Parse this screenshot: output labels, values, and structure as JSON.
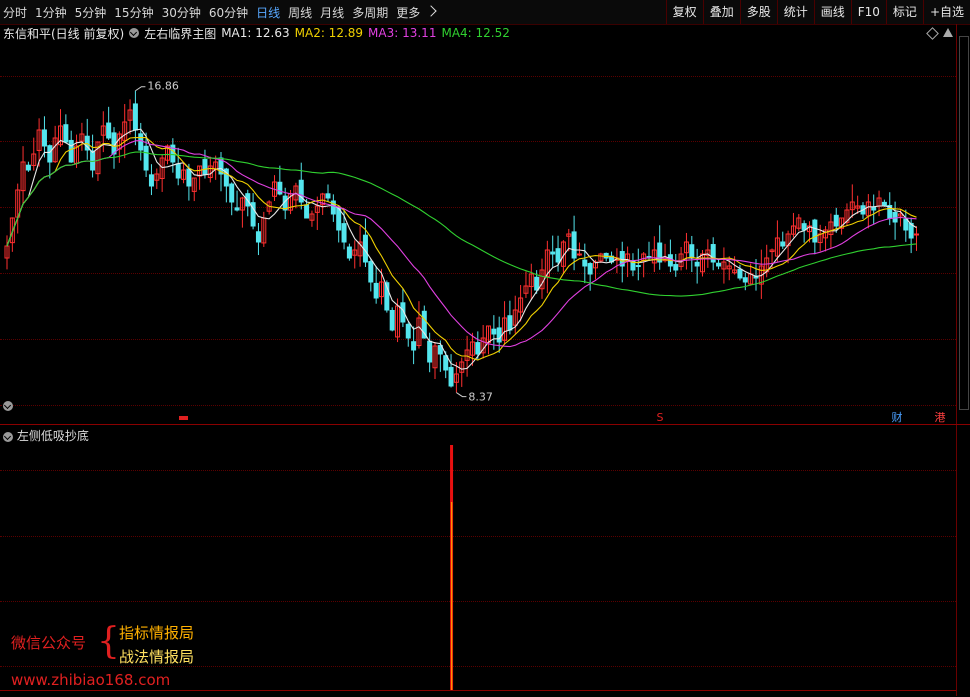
{
  "toolbar": {
    "periods": [
      {
        "label": "分时"
      },
      {
        "label": "1分钟"
      },
      {
        "label": "5分钟"
      },
      {
        "label": "15分钟"
      },
      {
        "label": "30分钟"
      },
      {
        "label": "60分钟"
      },
      {
        "label": "日线",
        "active": true
      },
      {
        "label": "周线"
      },
      {
        "label": "月线"
      },
      {
        "label": "多周期"
      },
      {
        "label": "更多"
      }
    ],
    "right_tools": [
      "复权",
      "叠加",
      "多股",
      "统计",
      "画线",
      "F10",
      "标记",
      "+自选"
    ]
  },
  "header": {
    "stock_name": "东信和平(日线 前复权)",
    "indicator": "左右临界主图",
    "ma": [
      {
        "label": "MA1: 12.63",
        "color": "#e8e8e8"
      },
      {
        "label": "MA2: 12.89",
        "color": "#f0d000"
      },
      {
        "label": "MA3: 13.11",
        "color": "#e040e0"
      },
      {
        "label": "MA4: 12.52",
        "color": "#30d030"
      }
    ]
  },
  "annotations": {
    "high": "16.86",
    "low": "8.37",
    "event_s": "S",
    "event_cai": "财",
    "event_gang": "港"
  },
  "sub_indicator": {
    "title": "左侧低吸抄底",
    "signal_day_index": 83
  },
  "watermark": {
    "wechat_label": "微信公众号",
    "brand1": "指标情报局",
    "brand2": "战法情报局",
    "site": "www.zhibiao168.com"
  },
  "colors": {
    "up": "#ff3030",
    "down": "#54e6ee",
    "ma1": "#e8e8e8",
    "ma2": "#f0d000",
    "ma3": "#e040e0",
    "ma4": "#30d030",
    "signal_red": "#e81010",
    "signal_orange": "#ff9a00"
  },
  "chart_data": {
    "type": "candlestick",
    "y_range": [
      8.0,
      17.5
    ],
    "closes": [
      12.1,
      12.8,
      13.5,
      14.2,
      14.0,
      14.4,
      15.0,
      14.6,
      14.2,
      14.8,
      15.1,
      14.7,
      14.2,
      14.6,
      14.9,
      14.5,
      14.0,
      14.7,
      15.1,
      14.8,
      14.4,
      14.9,
      15.2,
      15.5,
      15.0,
      14.5,
      14.0,
      13.6,
      13.9,
      14.3,
      14.6,
      14.2,
      13.8,
      14.0,
      13.6,
      13.8,
      14.1,
      13.9,
      14.1,
      14.2,
      13.9,
      13.6,
      13.2,
      13.0,
      13.3,
      13.1,
      12.6,
      12.2,
      12.8,
      13.2,
      13.7,
      13.4,
      13.0,
      13.4,
      13.6,
      13.2,
      12.8,
      12.9,
      13.1,
      13.4,
      13.3,
      12.9,
      12.5,
      12.2,
      11.8,
      12.0,
      12.2,
      11.7,
      11.2,
      10.8,
      11.2,
      10.5,
      10.0,
      10.6,
      10.2,
      9.8,
      9.5,
      10.3,
      9.8,
      9.2,
      9.6,
      9.4,
      9.0,
      8.6,
      8.9,
      9.2,
      9.5,
      9.7,
      9.4,
      9.8,
      10.1,
      9.9,
      9.7,
      10.3,
      10.0,
      10.5,
      10.8,
      11.1,
      11.4,
      11.0,
      11.5,
      12.0,
      11.9,
      11.7,
      12.2,
      12.4,
      11.8,
      11.9,
      11.6,
      11.4,
      11.7,
      11.9,
      11.8,
      11.7,
      11.8,
      11.6,
      11.9,
      11.5,
      11.6,
      11.9,
      11.8,
      12.0,
      11.7,
      11.8,
      11.6,
      11.5,
      11.9,
      12.2,
      11.8,
      11.6,
      11.9,
      12.0,
      11.7,
      11.6,
      11.7,
      11.6,
      11.5,
      11.3,
      11.2,
      11.4,
      11.3,
      11.6,
      11.8,
      12.0,
      12.3,
      12.1,
      12.4,
      12.6,
      12.8,
      12.5,
      12.6,
      12.2,
      12.4,
      12.5,
      12.7,
      12.6,
      12.8,
      13.0,
      13.2,
      13.1,
      12.9,
      13.2,
      13.0,
      13.3,
      13.1,
      12.8,
      12.7,
      12.9,
      12.5,
      12.3,
      12.4
    ]
  }
}
